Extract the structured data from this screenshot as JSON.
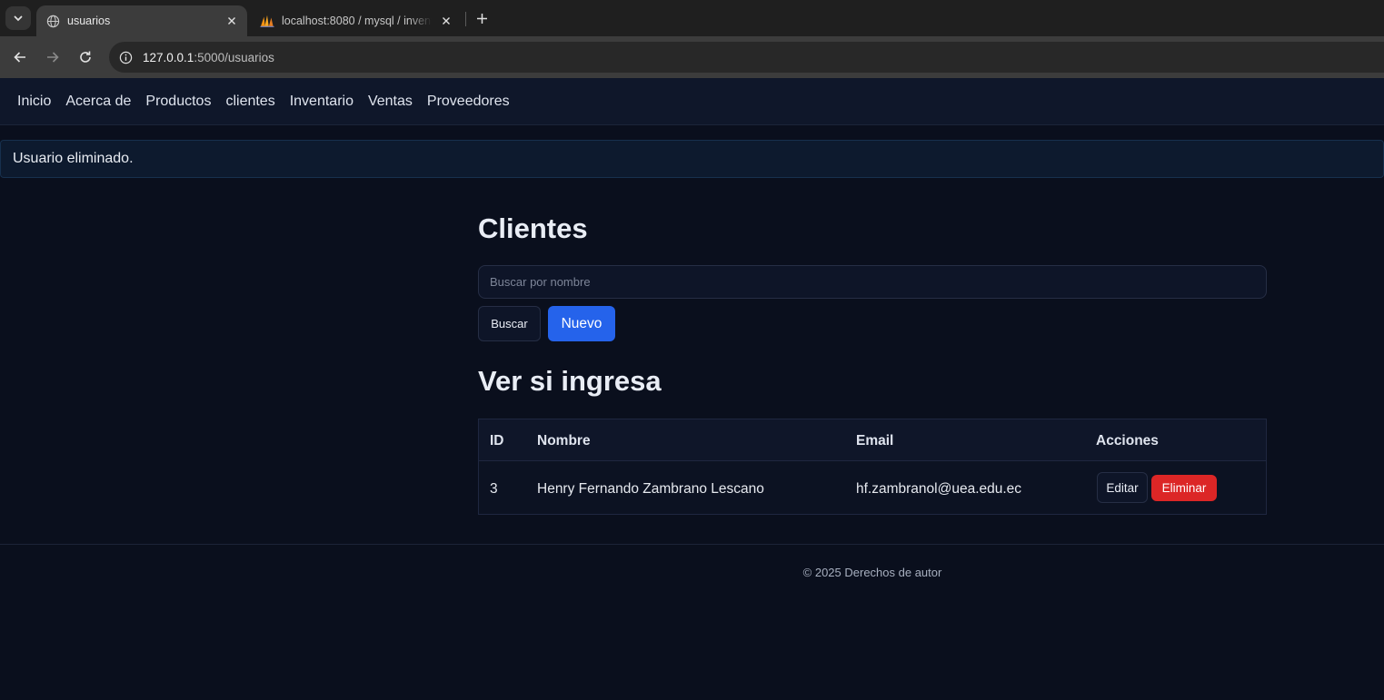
{
  "browser": {
    "tabs": [
      {
        "title": "usuarios",
        "icon": "globe-icon",
        "active": true
      },
      {
        "title": "localhost:8080 / mysql / inventario",
        "icon": "phpmyadmin-icon",
        "active": false
      }
    ],
    "url": {
      "host": "127.0.0.1",
      "path": ":5000/usuarios"
    }
  },
  "nav": {
    "items": [
      "Inicio",
      "Acerca de",
      "Productos",
      "clientes",
      "Inventario",
      "Ventas",
      "Proveedores"
    ]
  },
  "alert": {
    "text": "Usuario eliminado."
  },
  "main": {
    "title": "Clientes",
    "search_placeholder": "Buscar por nombre",
    "search_value": "",
    "search_button": "Buscar",
    "new_button": "Nuevo",
    "subtitle": "Ver si ingresa"
  },
  "table": {
    "headers": [
      "ID",
      "Nombre",
      "Email",
      "Acciones"
    ],
    "rows": [
      {
        "id": "3",
        "nombre": "Henry Fernando Zambrano Lescano",
        "email": "hf.zambranol@uea.edu.ec",
        "edit_label": "Editar",
        "delete_label": "Eliminar"
      }
    ]
  },
  "footer": {
    "text": "© 2025 Derechos de autor"
  },
  "colors": {
    "background": "#0a0f1d",
    "navbar": "#0f172a",
    "primary": "#2563eb",
    "danger": "#dc2626"
  }
}
